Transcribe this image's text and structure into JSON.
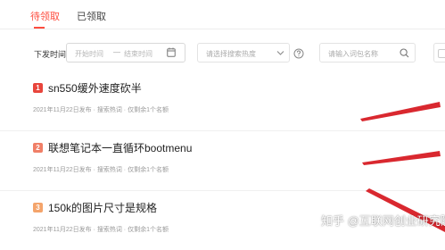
{
  "tabs": [
    {
      "label": "待领取",
      "active": true
    },
    {
      "label": "已领取",
      "active": false
    }
  ],
  "filters": {
    "time_label": "下发时间",
    "start_placeholder": "开始时间",
    "separator": "—",
    "end_placeholder": "结束时间",
    "heat_placeholder": "请选择搜索热度",
    "keyword_placeholder": "请输入词包名称"
  },
  "items": [
    {
      "rank": "1",
      "title": "sn550缓外速度砍半",
      "meta": "2021年11月22日发布 · 搜索热词 · 仅剩余1个名额"
    },
    {
      "rank": "2",
      "title": "联想笔记本一直循环bootmenu",
      "meta": "2021年11月22日发布 · 搜索热词 · 仅剩余1个名额"
    },
    {
      "rank": "3",
      "title": "150k的图片尺寸是规格",
      "meta": "2021年11月22日发布 · 搜索热词 · 仅剩余1个名额"
    }
  ],
  "watermark": "知乎 @互联网创业研究院",
  "colors": {
    "accent": "#fd4d3f",
    "rank1": "#e8453c",
    "rank2": "#f07f67",
    "rank3": "#f4a46b",
    "arrow": "#d9282f"
  },
  "icons": {
    "calendar": "calendar-icon",
    "chevron": "chevron-down-icon",
    "help": "help-circle-icon",
    "search": "search-icon"
  }
}
